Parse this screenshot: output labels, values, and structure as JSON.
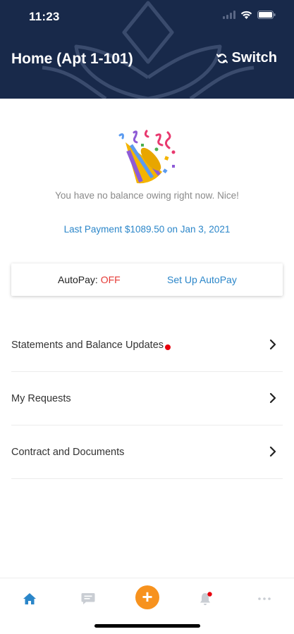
{
  "status_bar": {
    "time": "11:23",
    "icons": [
      "signal-icon",
      "wifi-icon",
      "battery-icon"
    ]
  },
  "header": {
    "title": "Home (Apt 1-101)",
    "switch_label": "Switch",
    "switch_icon": "refresh-icon",
    "background_color": "#18294a"
  },
  "balance": {
    "icon": "party-popper-icon",
    "message": "You have no balance owing right now. Nice!",
    "last_payment": "Last Payment $1089.50 on Jan 3, 2021"
  },
  "autopay": {
    "label": "AutoPay:",
    "status": "OFF",
    "status_color": "#e53935",
    "setup_link": "Set Up AutoPay"
  },
  "menu": {
    "items": [
      {
        "label": "Statements and Balance Updates",
        "has_notification_dot": true
      },
      {
        "label": "My Requests",
        "has_notification_dot": false
      },
      {
        "label": "Contract and Documents",
        "has_notification_dot": false
      }
    ]
  },
  "tab_bar": {
    "tabs": [
      {
        "icon": "home-icon",
        "active": true
      },
      {
        "icon": "messages-icon",
        "active": false
      },
      {
        "icon": "add-icon",
        "active": false
      },
      {
        "icon": "bell-icon",
        "active": false,
        "has_badge": true
      },
      {
        "icon": "more-icon",
        "active": false
      }
    ],
    "add_symbol": "+",
    "accent_color": "#f7921e",
    "active_color": "#2b86c9"
  },
  "link_color": "#2b86c9"
}
